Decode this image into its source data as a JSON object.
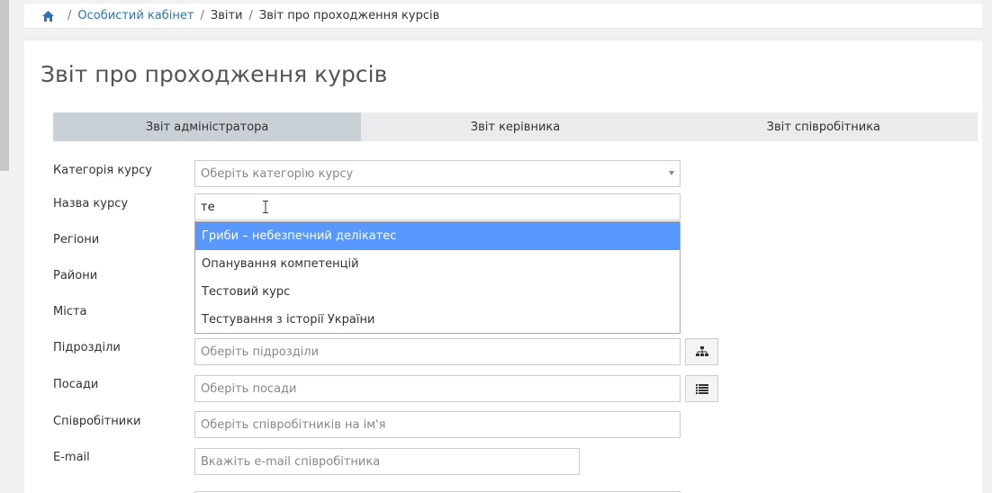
{
  "breadcrumb": {
    "home_icon": "home-icon",
    "items": [
      "Особистий кабінет",
      "Звіти",
      "Звіт про проходження курсів"
    ]
  },
  "page": {
    "title": "Звіт про проходження курсів"
  },
  "tabs": [
    {
      "label": "Звіт адміністратора",
      "active": true
    },
    {
      "label": "Звіт керівника",
      "active": false
    },
    {
      "label": "Звіт співробітника",
      "active": false
    }
  ],
  "form": {
    "category": {
      "label": "Категорія курсу",
      "placeholder": "Оберіть категорію курсу"
    },
    "course_name": {
      "label": "Назва курсу",
      "value": "те"
    },
    "regions": {
      "label": "Регіони"
    },
    "districts": {
      "label": "Райони"
    },
    "cities": {
      "label": "Міста"
    },
    "subdivisions": {
      "label": "Підрозділи",
      "placeholder": "Оберіть підрозділи"
    },
    "positions": {
      "label": "Посади",
      "placeholder": "Оберіть посади"
    },
    "employees": {
      "label": "Співробітники",
      "placeholder": "Оберіть співробітників на ім'я"
    },
    "email": {
      "label": "E-mail",
      "placeholder": "Вкажіть e-mail співробітника"
    }
  },
  "dropdown": {
    "items": [
      "Гриби – небезпечний делікатес",
      "Опанування компетенцій",
      "Тестовий курс",
      "Тестування з історії України"
    ],
    "highlighted_index": 0
  },
  "colors": {
    "link": "#2a74b8",
    "tab_active": "#c9d0d6",
    "dropdown_highlight": "#5897fb"
  }
}
